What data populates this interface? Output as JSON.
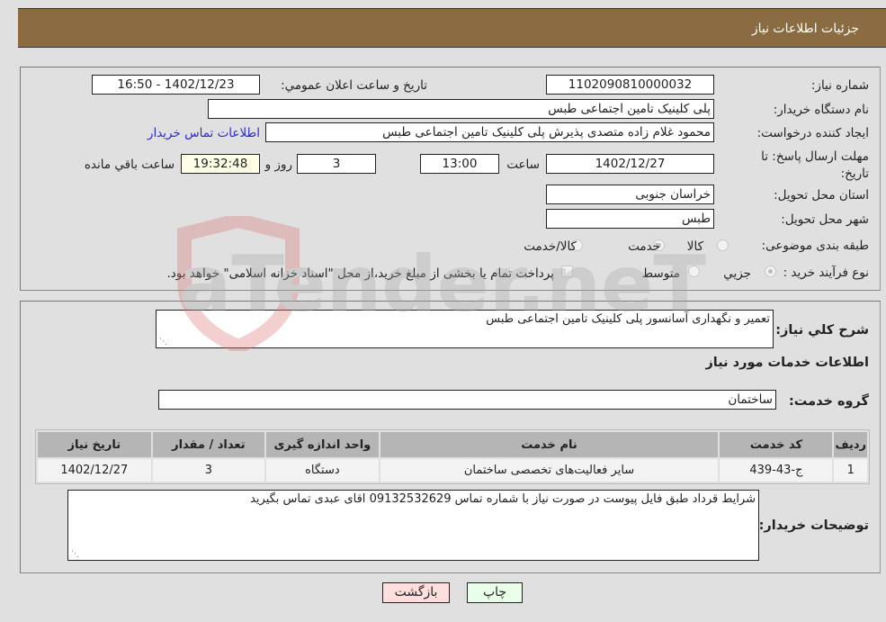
{
  "header": {
    "title": "جزئیات اطلاعات نیاز"
  },
  "info": {
    "need_number_label": "شماره نیاز:",
    "need_number": "1102090810000032",
    "announce_label": "تاریخ و ساعت اعلان عمومي:",
    "announce_value": "1402/12/23 - 16:50",
    "buyer_org_label": "نام دستگاه خریدار:",
    "buyer_org": "پلی کلینیک تامین اجتماعی طبس",
    "creator_label": "ایجاد کننده درخواست:",
    "creator": "محمود غلام زاده  متصدی پذیرش پلی کلینیک تامین اجتماعی طبس",
    "contact_link": "اطلاعات تماس خریدار",
    "deadline_label": "مهلت ارسال پاسخ: تا تاریخ:",
    "deadline_date": "1402/12/27",
    "time_label": "ساعت",
    "deadline_time": "13:00",
    "days": "3",
    "days_label": "روز و",
    "remaining_time": "19:32:48",
    "remaining_label": "ساعت باقي مانده",
    "province_label": "استان محل تحویل:",
    "province": "خراسان جنوبی",
    "city_label": "شهر محل تحویل:",
    "city": "طبس",
    "category_label": "طبقه بندی موضوعی:",
    "category_options": [
      {
        "label": "کالا",
        "selected": false
      },
      {
        "label": "خدمت",
        "selected": true
      },
      {
        "label": "کالا/خدمت",
        "selected": false
      }
    ],
    "process_label": "نوع فرآیند خرید :",
    "process_options": [
      {
        "label": "جزيي",
        "selected": true
      },
      {
        "label": "متوسط",
        "selected": false
      }
    ],
    "treasury_note": "پرداخت تمام یا بخشی از مبلغ خرید،از محل \"اسناد خزانه اسلامی\" خواهد بود.",
    "treasury_checked": false
  },
  "services": {
    "description_label": "شرح کلي نیاز:",
    "description": "تعمیر و نگهداری آسانسور پلی کلینیک تامین اجتماعی طبس",
    "section_title": "اطلاعات خدمات مورد نیاز",
    "group_label": "گروه خدمت:",
    "group": "ساختمان",
    "table": {
      "columns": [
        "ردیف",
        "کد خدمت",
        "نام خدمت",
        "واحد اندازه گیری",
        "تعداد / مقدار",
        "تاریخ نیاز"
      ],
      "rows": [
        [
          "1",
          "ج-43-439",
          "سایر فعالیت‌های تخصصی ساختمان",
          "دستگاه",
          "3",
          "1402/12/27"
        ]
      ]
    },
    "buyer_notes_label": "توضیحات خریدار:",
    "buyer_notes": "شرایط قرداد طبق  فایل پیوست در صورت نیاز با شماره تماس 09132532629 اقای عبدی تماس بگیرید"
  },
  "buttons": {
    "print": "چاپ",
    "back": "بازگشت"
  },
  "watermark": {
    "text": "AriaTender.neT"
  },
  "colors": {
    "header_bg": "#8b6b42",
    "link": "#2b2bd0",
    "print_bg": "#eaffea",
    "back_bg": "#ffdede"
  }
}
